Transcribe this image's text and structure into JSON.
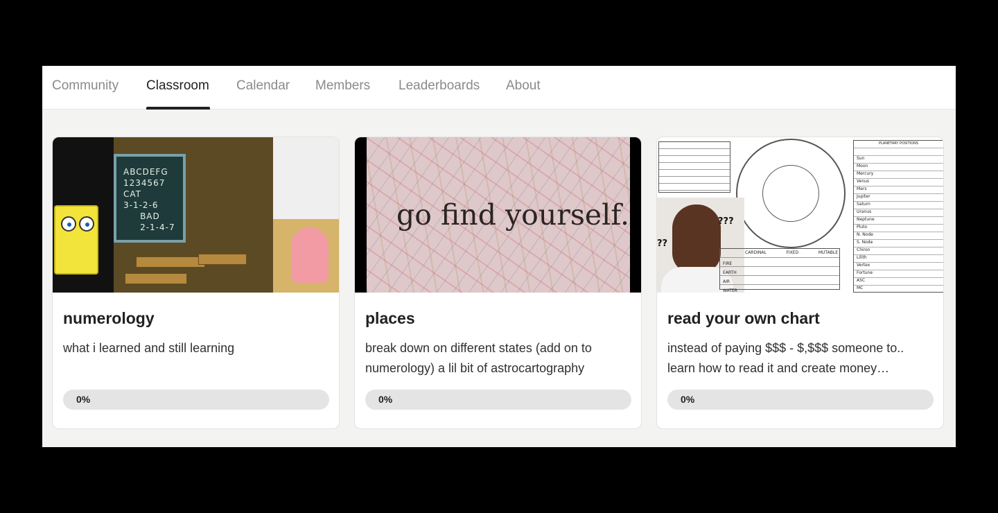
{
  "tabs": [
    {
      "label": "Community",
      "active": false
    },
    {
      "label": "Classroom",
      "active": true
    },
    {
      "label": "Calendar",
      "active": false
    },
    {
      "label": "Members",
      "active": false
    },
    {
      "label": "Leaderboards",
      "active": false
    },
    {
      "label": "About",
      "active": false
    }
  ],
  "colors": {
    "background": "#000000",
    "panel": "#f3f3f2",
    "card": "#ffffff",
    "progress_track": "#e4e4e4",
    "active_tab": "#202124",
    "inactive_tab": "#8a8a8a"
  },
  "courses": [
    {
      "title": "numerology",
      "description": "what i learned and still learning",
      "progress_label": "0%",
      "progress": 0,
      "thumbnail": {
        "board_text": "ABCDEFG\n1234567\nCAT\n3-1-2-6\n     BAD\n     2-1-4-7"
      }
    },
    {
      "title": "places",
      "description": "break down on different states (add on to numerology) a lil bit of astrocartography",
      "progress_label": "0%",
      "progress": 0,
      "thumbnail": {
        "overlay_text": "go find yourself."
      }
    },
    {
      "title": "read your own chart",
      "description": "instead of paying $$$ - $,$$$ someone to.. learn how to read it and create money…",
      "progress_label": "0%",
      "progress": 0,
      "thumbnail": {
        "question_marks": [
          "???",
          "??"
        ],
        "planetary_header": "PLANETARY POSITIONS",
        "planets": [
          "Sun",
          "Moon",
          "Mercury",
          "Venus",
          "Mars",
          "Jupiter",
          "Saturn",
          "Uranus",
          "Neptune",
          "Pluto",
          "N. Node",
          "S. Node",
          "Chiron",
          "Lilith",
          "Vertex",
          "Fortune",
          "ASC",
          "MC"
        ],
        "element_columns": [
          "CARDINAL",
          "FIXED",
          "MUTABLE"
        ],
        "element_rows": [
          "FIRE",
          "EARTH",
          "AIR",
          "WATER"
        ]
      }
    }
  ]
}
